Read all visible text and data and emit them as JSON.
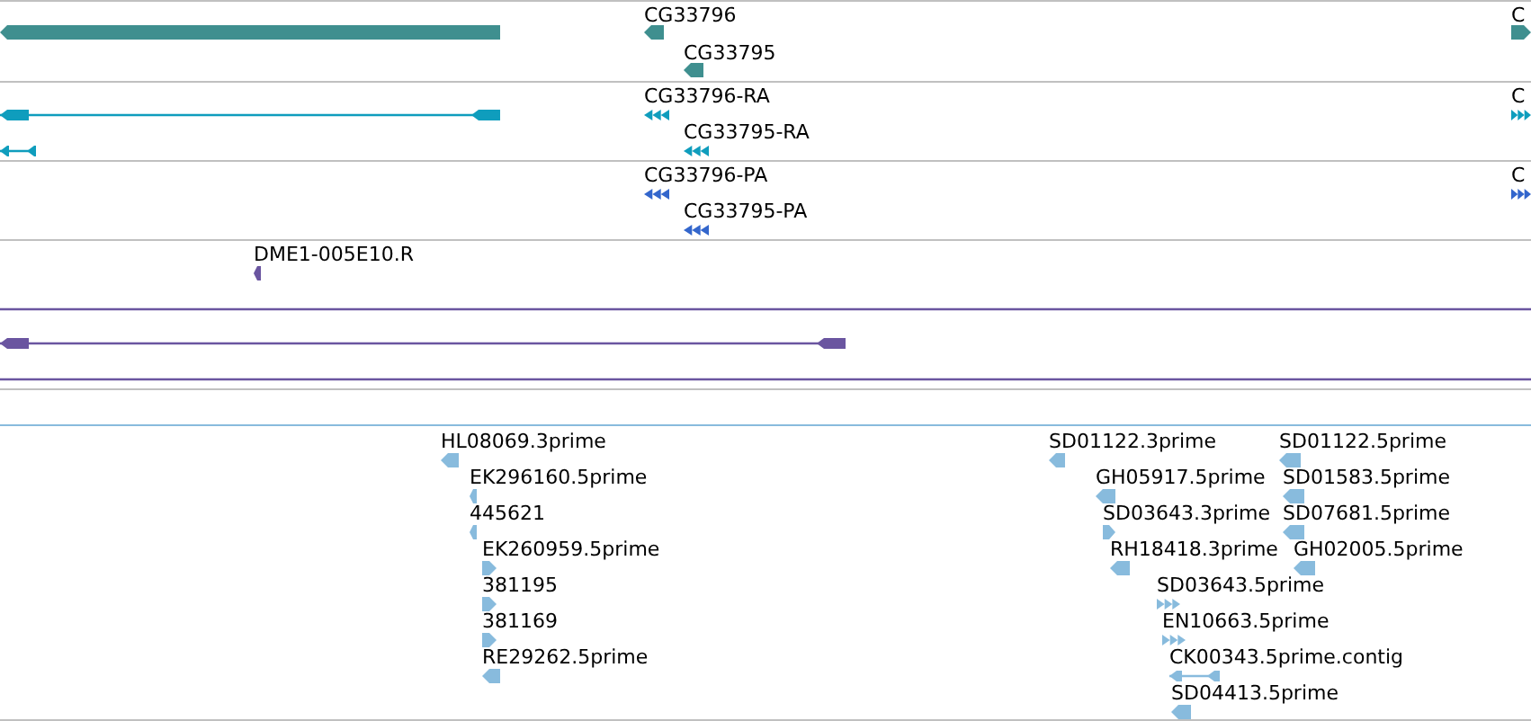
{
  "tracks": [
    {
      "kind": "gene",
      "color": "#3f8f8f",
      "features": [
        {
          "kind": "block",
          "reverse_strand": true
        },
        {
          "label": "CG33796",
          "kind": "block",
          "reverse_strand": true
        },
        {
          "label": "CG33795",
          "kind": "block",
          "reverse_strand": true
        },
        {
          "label": "C",
          "kind": "block",
          "reverse_strand": false
        }
      ]
    },
    {
      "kind": "transcript",
      "color": "#0f9dbd",
      "features": [
        {
          "kind": "transcript",
          "reverse_strand": true
        },
        {
          "kind": "transcript",
          "reverse_strand": true
        },
        {
          "label": "CG33796-RA",
          "kind": "chevrons",
          "reverse_strand": true
        },
        {
          "label": "CG33795-RA",
          "kind": "chevrons",
          "reverse_strand": true
        },
        {
          "label": "C",
          "kind": "chevrons",
          "reverse_strand": false
        }
      ]
    },
    {
      "kind": "protein",
      "color": "#3366cc",
      "features": [
        {
          "label": "CG33796-PA",
          "kind": "chevrons",
          "reverse_strand": true
        },
        {
          "label": "CG33795-PA",
          "kind": "chevrons",
          "reverse_strand": true
        },
        {
          "label": "C",
          "kind": "chevrons",
          "reverse_strand": false
        }
      ]
    },
    {
      "kind": "clone",
      "color": "#6a55a0",
      "features": [
        {
          "label": "DME1-005E10.R",
          "kind": "block",
          "reverse_strand": true
        },
        {
          "kind": "line"
        },
        {
          "kind": "transcript",
          "reverse_strand": true
        },
        {
          "kind": "line"
        }
      ]
    },
    {
      "kind": "empty"
    },
    {
      "kind": "est",
      "color": "#88bbdd",
      "features": [
        {
          "label": "HL08069.3prime",
          "kind": "block",
          "reverse_strand": true
        },
        {
          "label": "EK296160.5prime",
          "kind": "block",
          "reverse_strand": true
        },
        {
          "label": "445621",
          "kind": "block",
          "reverse_strand": true
        },
        {
          "label": "EK260959.5prime",
          "kind": "block",
          "reverse_strand": false
        },
        {
          "label": "381195",
          "kind": "block",
          "reverse_strand": false
        },
        {
          "label": "381169",
          "kind": "block",
          "reverse_strand": false
        },
        {
          "label": "RE29262.5prime",
          "kind": "block",
          "reverse_strand": true
        },
        {
          "label": "SD01122.3prime",
          "kind": "block",
          "reverse_strand": true
        },
        {
          "label": "GH05917.5prime",
          "kind": "block",
          "reverse_strand": true
        },
        {
          "label": "SD03643.3prime",
          "kind": "block",
          "reverse_strand": false
        },
        {
          "label": "RH18418.3prime",
          "kind": "block",
          "reverse_strand": true
        },
        {
          "label": "SD03643.5prime",
          "kind": "chevrons",
          "reverse_strand": false
        },
        {
          "label": "EN10663.5prime",
          "kind": "chevrons",
          "reverse_strand": false
        },
        {
          "label": "CK00343.5prime.contig",
          "kind": "transcript",
          "reverse_strand": true
        },
        {
          "label": "SD04413.5prime",
          "kind": "block",
          "reverse_strand": true
        },
        {
          "label": "SD01122.5prime",
          "kind": "block",
          "reverse_strand": true
        },
        {
          "label": "SD01583.5prime",
          "kind": "block",
          "reverse_strand": true
        },
        {
          "label": "SD07681.5prime",
          "kind": "block",
          "reverse_strand": true
        },
        {
          "label": "GH02005.5prime",
          "kind": "block",
          "reverse_strand": true
        }
      ]
    }
  ]
}
